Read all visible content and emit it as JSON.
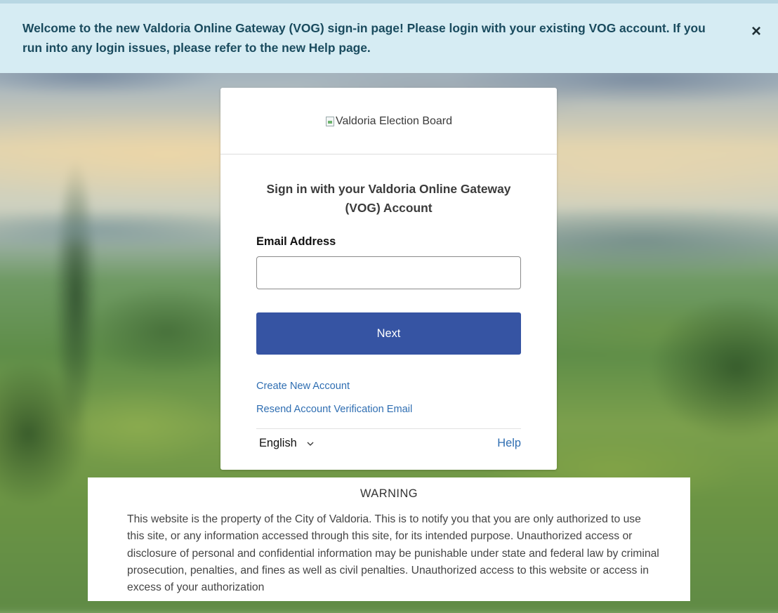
{
  "banner": {
    "message": "Welcome to the new Valdoria Online Gateway (VOG) sign-in page! Please login with your existing VOG account. If you run into any login issues, please refer to the new Help page.",
    "close_glyph": "×"
  },
  "card": {
    "logo_alt": "Valdoria Election Board",
    "title": "Sign in with your Valdoria Online Gateway (VOG) Account",
    "email_label": "Email Address",
    "email_value": "",
    "next_label": "Next",
    "create_account_link": "Create New Account",
    "resend_link": "Resend Account Verification Email",
    "language": "English",
    "help_link": "Help"
  },
  "warning": {
    "title": "WARNING",
    "body": "This website is the property of the City of Valdoria. This is to notify you that you are only authorized to use this site, or any information accessed through this site, for its intended purpose. Unauthorized access or disclosure of personal and confidential information may be punishable under state and federal law by criminal prosecution, penalties, and fines as well as civil penalties. Unauthorized access to this website or access in excess of your authorization"
  },
  "colors": {
    "banner_bg": "#d6ecf3",
    "banner_text": "#1a4b5e",
    "primary_button": "#3654a3",
    "link": "#2f6eb2"
  },
  "icons": {
    "close": "close-icon",
    "language_dropdown": "chevron-down-icon",
    "logo": "broken-image-icon"
  }
}
